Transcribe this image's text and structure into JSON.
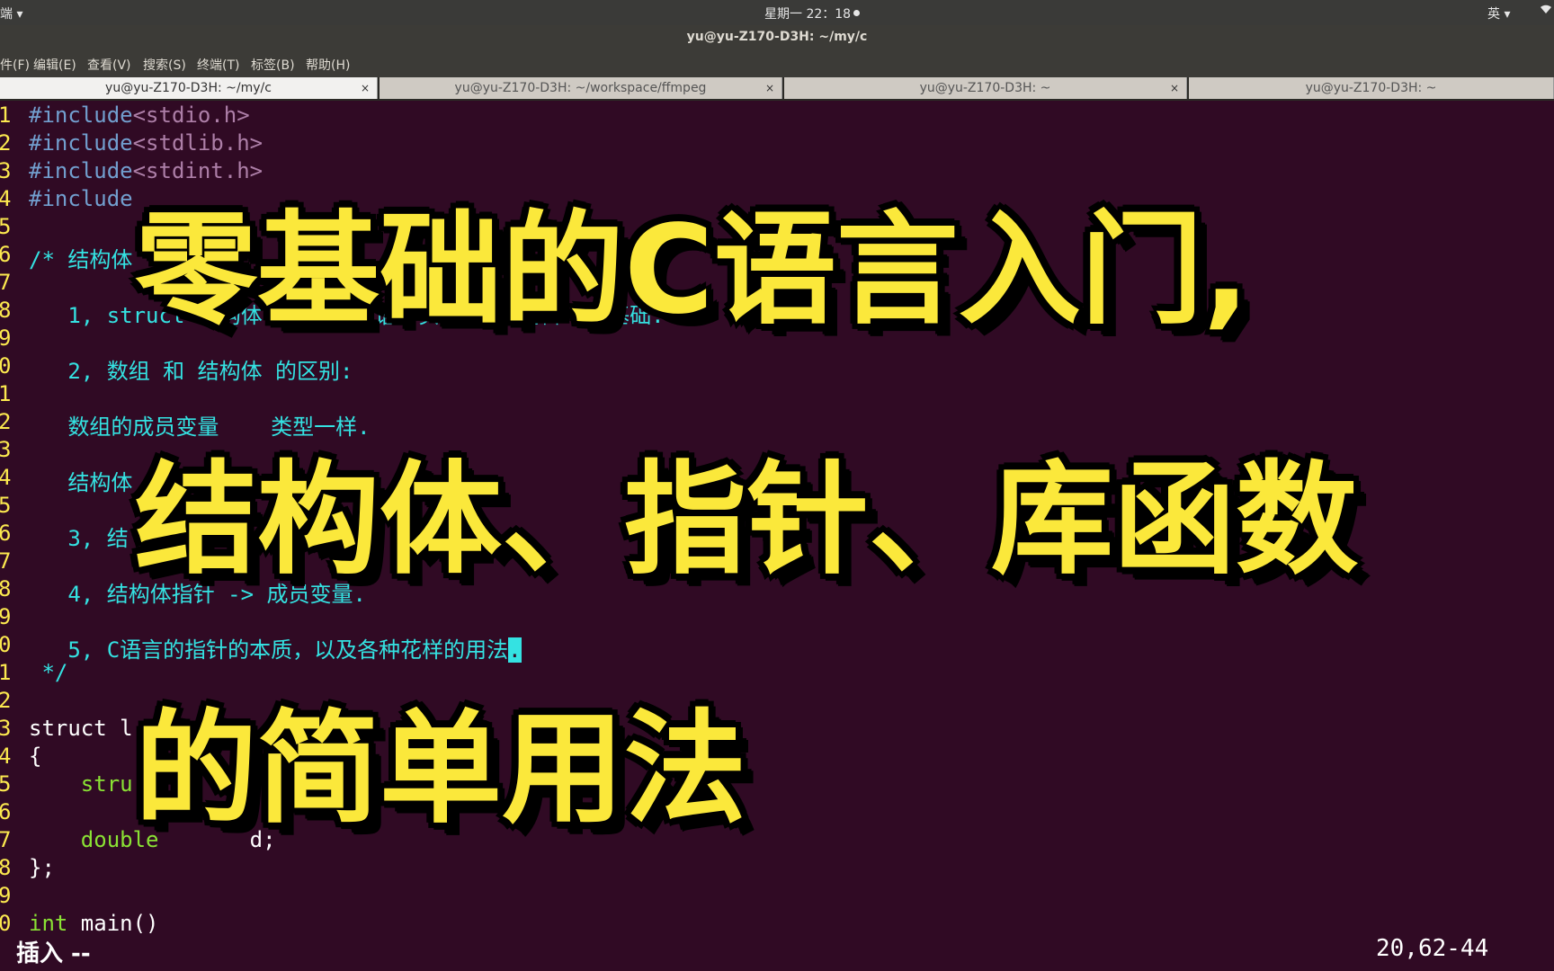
{
  "topbar": {
    "app_label": "端 ▾",
    "clock": "星期一 22：18",
    "ime": "英 ▾",
    "net_icon": "▾"
  },
  "window": {
    "title": "yu@yu-Z170-D3H: ~/my/c"
  },
  "menu": [
    "件(F)",
    "编辑(E)",
    "查看(V)",
    "搜索(S)",
    "终端(T)",
    "标签(B)",
    "帮助(H)"
  ],
  "tabs": [
    {
      "label": "yu@yu-Z170-D3H: ~/my/c",
      "close": "×"
    },
    {
      "label": "yu@yu-Z170-D3H: ~/workspace/ffmpeg",
      "close": "×"
    },
    {
      "label": "yu@yu-Z170-D3H: ~",
      "close": "×"
    },
    {
      "label": "yu@yu-Z170-D3H: ~",
      "close": ""
    }
  ],
  "editor": {
    "lines": [
      {
        "n": "1",
        "a": "#include",
        "b": "<stdio.h>"
      },
      {
        "n": "2",
        "a": "#include",
        "b": "<stdlib.h>"
      },
      {
        "n": "3",
        "a": "#include",
        "b": "<stdint.h>"
      },
      {
        "n": "4",
        "a": "#include",
        "b": ""
      },
      {
        "n": "5",
        "a": "",
        "b": ""
      },
      {
        "n": "6",
        "a": "/* 结构体",
        "b": ""
      },
      {
        "n": "7",
        "a": "",
        "b": ""
      },
      {
        "n": "8",
        "a": "   1, struct 结构体 关键字，C语言实现 复杂逻辑  的基础.",
        "b": ""
      },
      {
        "n": "9",
        "a": "",
        "b": ""
      },
      {
        "n": "0",
        "a": "   2, 数组 和 结构体 的区别:",
        "b": ""
      },
      {
        "n": "1",
        "a": "",
        "b": ""
      },
      {
        "n": "2",
        "a": "   数组的成员变量    类型一样.",
        "b": ""
      },
      {
        "n": "3",
        "a": "",
        "b": ""
      },
      {
        "n": "4",
        "a": "   结构体",
        "b": ""
      },
      {
        "n": "5",
        "a": "",
        "b": ""
      },
      {
        "n": "6",
        "a": "   3, 结",
        "b": ""
      },
      {
        "n": "7",
        "a": "",
        "b": ""
      },
      {
        "n": "8",
        "a": "   4, 结构体指针 -> 成员变量.",
        "b": ""
      },
      {
        "n": "9",
        "a": "",
        "b": ""
      },
      {
        "n": "0",
        "a": "   5, C语言的指针的本质，以及各种花样的用法",
        "b": "."
      },
      {
        "n": "1",
        "a": " */",
        "b": ""
      },
      {
        "n": "2",
        "a": "",
        "b": ""
      },
      {
        "n": "3",
        "a": "struct l",
        "b": ""
      },
      {
        "n": "4",
        "a": "{",
        "b": ""
      },
      {
        "n": "5",
        "a": "    stru",
        "b": ""
      },
      {
        "n": "6",
        "a": "",
        "b": ""
      },
      {
        "n": "7",
        "a": "    double",
        "b": "       d;"
      },
      {
        "n": "8",
        "a": "};",
        "b": ""
      },
      {
        "n": "9",
        "a": "",
        "b": ""
      },
      {
        "n": "0",
        "a": "int",
        "b": " main()"
      }
    ],
    "mode": "插入 --",
    "position": "20,62-44"
  },
  "overlay": {
    "line1": "零基础的C语言入门,",
    "line2": "结构体、指针、库函数",
    "line3": "的简单用法"
  }
}
